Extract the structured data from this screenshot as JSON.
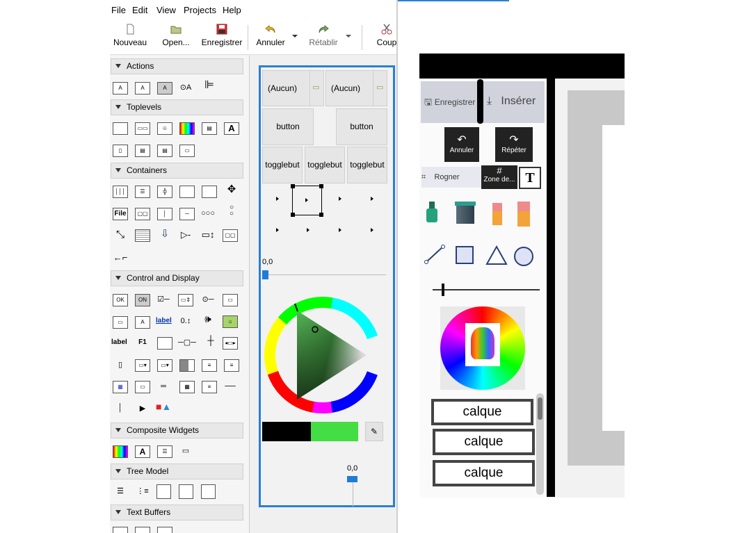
{
  "menu": [
    "File",
    "Edit",
    "View",
    "Projects",
    "Help"
  ],
  "toolbar": {
    "new_label": "Nouveau",
    "open_label": "Open...",
    "save_label": "Enregistrer",
    "undo_label": "Annuler",
    "redo_label": "Rétablir",
    "cut_label": "Coup"
  },
  "palette": {
    "sections": [
      "Actions",
      "Toplevels",
      "Containers",
      "Control and Display",
      "Composite Widgets",
      "Tree Model",
      "Text Buffers"
    ],
    "icon_texts": {
      "file": "File",
      "label_link": "label",
      "label_bold": "label",
      "f1": "F1",
      "a": "A",
      "ok": "OK",
      "on": "ON"
    }
  },
  "design": {
    "none_1": "(Aucun)",
    "none_2": "(Aucun)",
    "button_1": "button",
    "button_2": "button",
    "toggle_1": "togglebut",
    "toggle_2": "togglebut",
    "toggle_3": "togglebut",
    "scale_value_1": "0,0",
    "scale_value_2": "0,0"
  },
  "image_panel": {
    "save_label": "Enregistrer",
    "insert_label": "Insérer",
    "undo_label": "Annuler",
    "redo_label": "Répéter",
    "crop_label": "Rogner",
    "zone_label": "Zone de...",
    "text_tool": "T",
    "layers": [
      "calque",
      "calque",
      "calque"
    ]
  },
  "colors": {
    "selection_blue": "#2a7fd4",
    "swatch_green": "#44dd44",
    "swatch_black": "#000000"
  }
}
